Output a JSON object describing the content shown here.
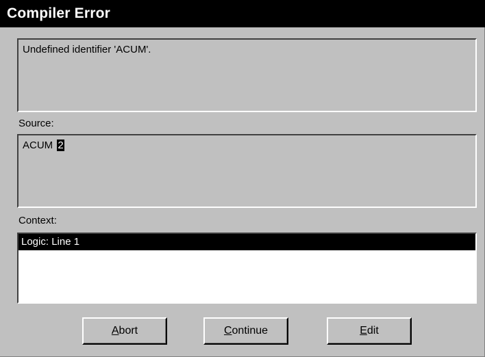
{
  "dialog": {
    "title": "Compiler Error"
  },
  "error": {
    "message": "Undefined identifier 'ACUM'."
  },
  "source": {
    "label": "Source:",
    "text_before_cursor": "ACUM ",
    "highlighted_char": "2"
  },
  "context": {
    "label": "Context:",
    "items": [
      {
        "label": "Logic: Line 1",
        "selected": true
      }
    ]
  },
  "buttons": {
    "abort": {
      "mnemonic": "A",
      "rest": "bort"
    },
    "continue": {
      "mnemonic": "C",
      "rest": "ontinue"
    },
    "edit": {
      "mnemonic": "E",
      "rest": "dit"
    }
  },
  "colors": {
    "window_bg": "#c0c0c0",
    "titlebar_bg": "#000000",
    "titlebar_text": "#ffffff",
    "selection_bg": "#000000",
    "list_bg": "#ffffff"
  }
}
